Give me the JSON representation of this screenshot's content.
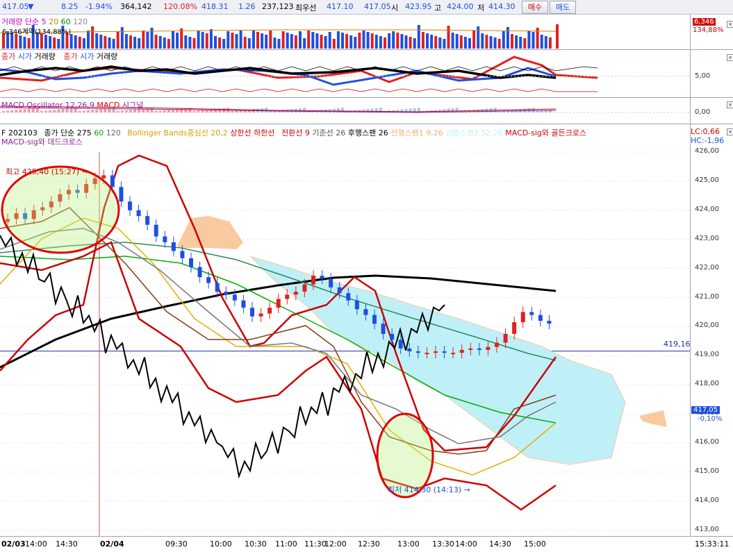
{
  "ticker": {
    "price": "417.05",
    "arrow": "▼",
    "change": "8.25",
    "change_pct": "-1.94%",
    "volume": "364,142",
    "volume_ratio": "120.08%",
    "prev_price": "418.31",
    "diff": "1.26",
    "open_interest": "237,123",
    "best_label": "최우선",
    "best_bid": "417.10",
    "best_ask": "417.05",
    "open_label": "시",
    "open": "423.95",
    "high_label": "고",
    "high": "424.00",
    "low_label": "저",
    "low": "414.30",
    "buy_label": "매수",
    "sell_label": "매도"
  },
  "volume_panel": {
    "legend_name": "거래량",
    "legend_ma": "단순",
    "legend_p1": "5",
    "legend_p2": "20",
    "legend_p3": "60",
    "legend_p4": "120",
    "contract_label": "6,346계약(134,88%)",
    "value": "6,346",
    "ratio": "134,88%"
  },
  "compare_panel": {
    "legend": [
      "종가",
      "시가",
      "거래량",
      "종가",
      "시가",
      "거래량"
    ],
    "tick": "5,00"
  },
  "macd_panel": {
    "legend_osc": "MACD Oscillator 12,26,9",
    "legend_macd": "MACD",
    "legend_signal": "시그널",
    "tick": "0,00"
  },
  "main_panel": {
    "code": "F 202103",
    "close_ma": "종가 단순 275",
    "p60": "60",
    "p120": "120",
    "bb": "Bollinger Bands중심선 20,2",
    "upper": "상한선",
    "lower": "하한선",
    "conv": "전환선 9",
    "base": "기준선 26",
    "lagging": "후행스팬 26",
    "lead1": "선행스팬1 9,26",
    "lead2": "선행스팬2 52,26",
    "golden": "MACD-sig와 골든크로스",
    "dead": "MACD-sig와 데드크로스",
    "lc": "LC:0,66",
    "hc": "HC:-1,96",
    "high_note": "최고 425,40 (15:27) →",
    "low_note": "최저 414,30 (14:13) →",
    "hline_value": "419,16",
    "last_price": "417,05",
    "last_pct": "-0,10%",
    "yticks": [
      "426,00",
      "425,00",
      "424,00",
      "423,00",
      "422,00",
      "421,00",
      "420,00",
      "419,00",
      "418,00",
      "417,00",
      "416,00",
      "415,00",
      "414,00",
      "413,00"
    ],
    "xticks": [
      "02/03",
      "14:00",
      "14:30",
      "02/04",
      "09:30",
      "10:00",
      "10:30",
      "11:00",
      "11:30",
      "12:00",
      "12:30",
      "13:00",
      "13:30",
      "14:00",
      "14:30",
      "15:00"
    ],
    "time": "15:33:11"
  },
  "colors": {
    "up": "#e02020",
    "down": "#1f4fe0",
    "cloud_blue": "#bff0f8",
    "cloud_orange": "#f9c9a0",
    "accent": "#cc0000"
  }
}
